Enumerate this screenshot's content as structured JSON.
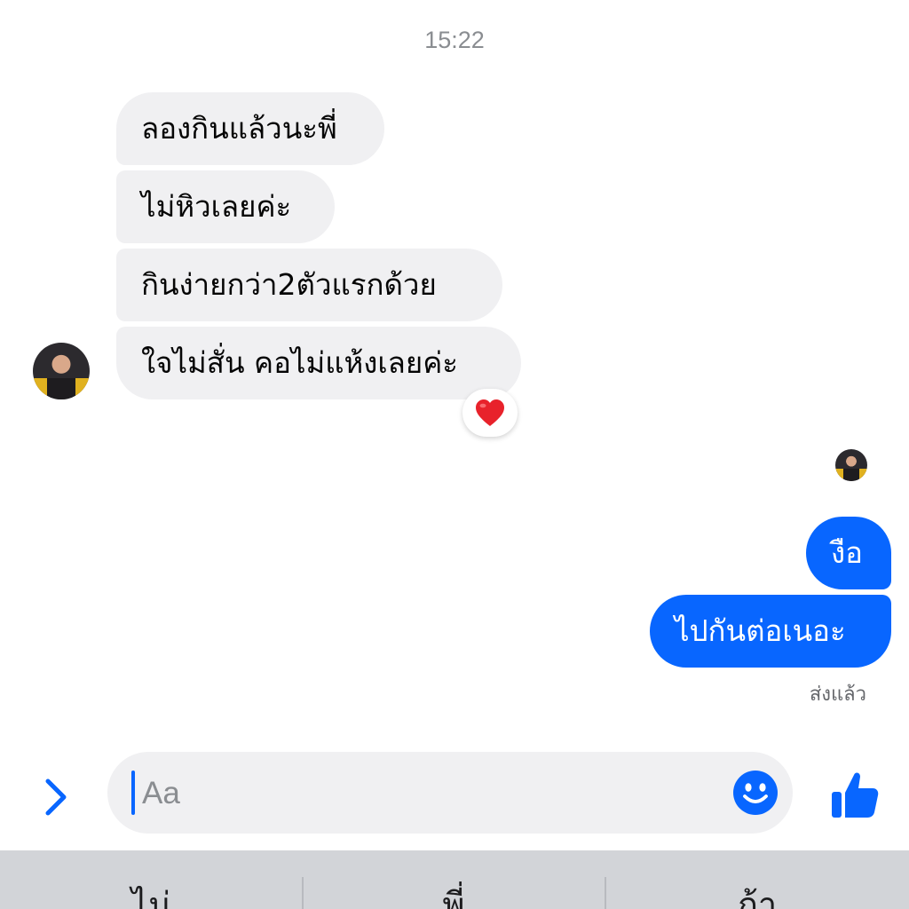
{
  "conversation": {
    "timestamp": "15:22",
    "received": [
      {
        "text": "ลองกินแล้วนะพี่"
      },
      {
        "text": "ไม่หิวเลยค่ะ"
      },
      {
        "text": "กินง่ายกว่า2ตัวแรกด้วย"
      },
      {
        "text": "ใจไม่สั่น คอไม่แห้งเลยค่ะ"
      }
    ],
    "reaction": "heart-icon",
    "sent": [
      {
        "text": "งือ"
      },
      {
        "text": "ไปกันต่อเนอะ"
      }
    ],
    "delivery_status": "ส่งแล้ว"
  },
  "composer": {
    "placeholder": "Aa",
    "expand_icon": "chevron-right-icon",
    "emoji_icon": "smiley-icon",
    "like_icon": "thumbs-up-icon"
  },
  "keyboard": {
    "suggestions": [
      "ไม่",
      "พี่",
      "ถ้า"
    ]
  },
  "colors": {
    "accent": "#0866ff",
    "incoming_bubble": "#f0f0f2",
    "reaction_heart": "#e8222b",
    "keyboard_bar": "#d2d4d8"
  }
}
